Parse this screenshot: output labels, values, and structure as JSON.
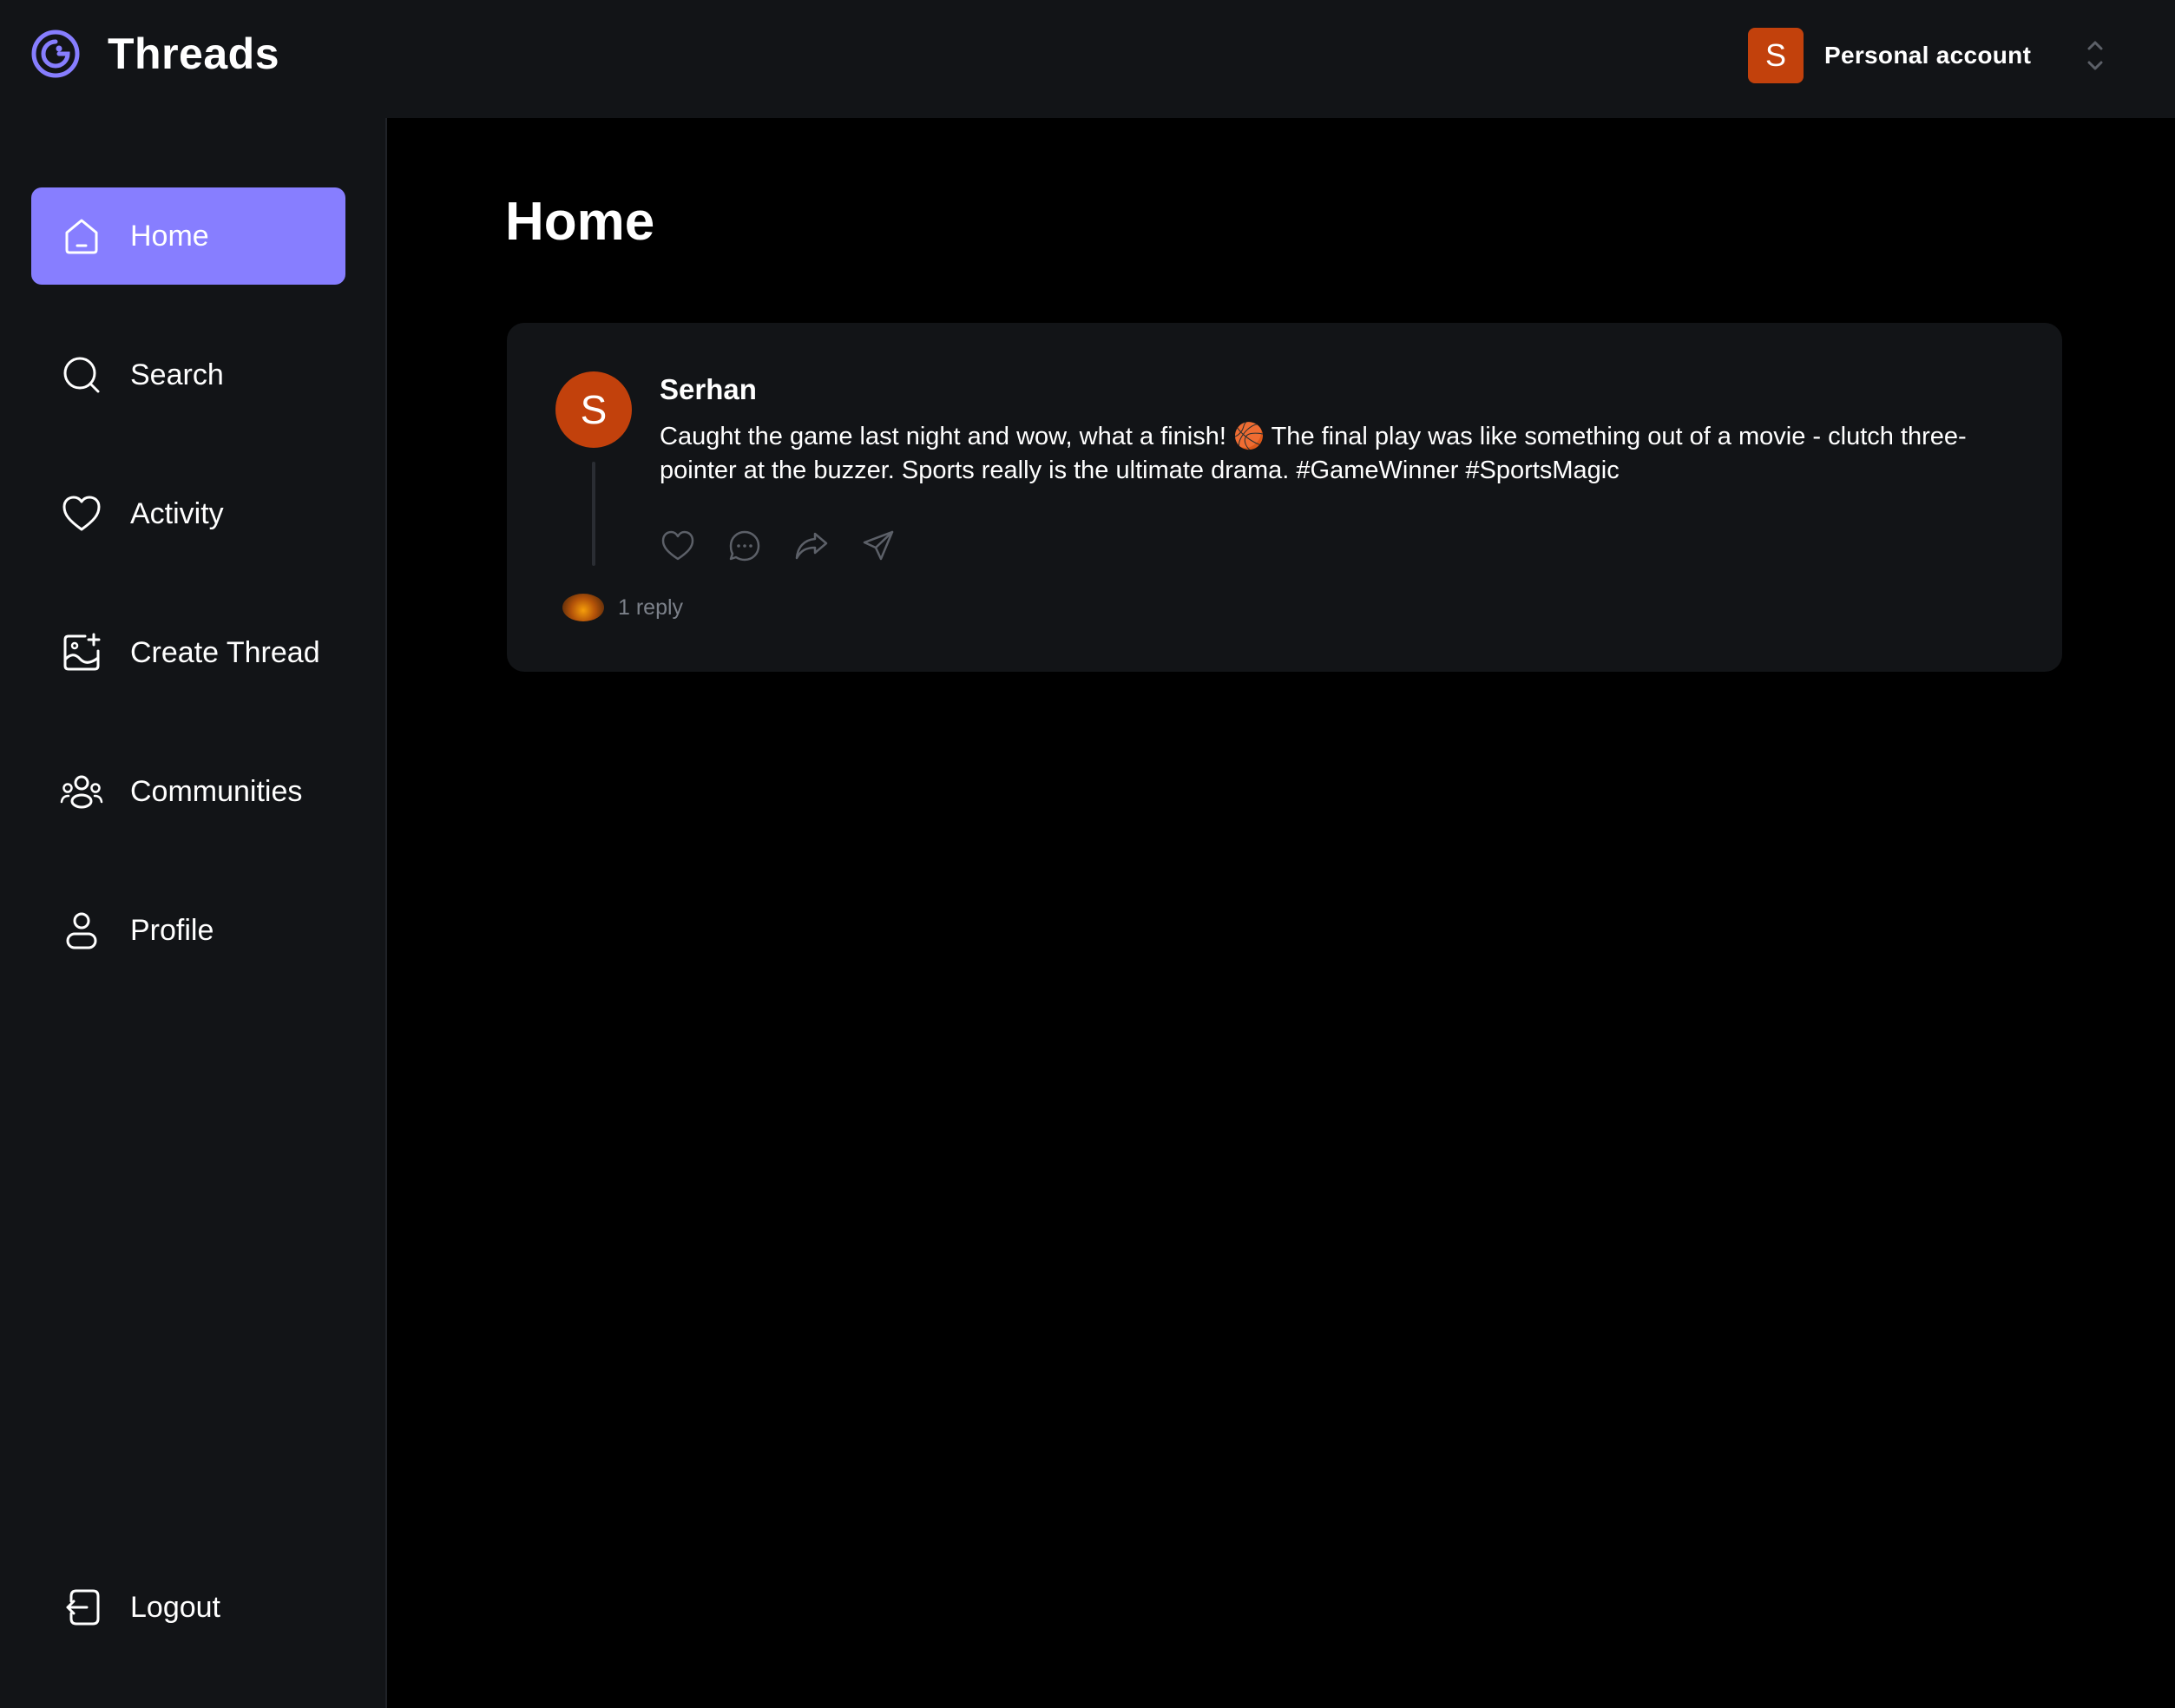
{
  "app": {
    "title": "Threads",
    "accent_color": "#877eff"
  },
  "account": {
    "avatar_letter": "S",
    "avatar_color": "#c2410c",
    "label": "Personal account"
  },
  "sidebar": {
    "items": [
      {
        "label": "Home",
        "icon": "home-icon",
        "active": true
      },
      {
        "label": "Search",
        "icon": "search-icon",
        "active": false
      },
      {
        "label": "Activity",
        "icon": "heart-icon",
        "active": false
      },
      {
        "label": "Create Thread",
        "icon": "image-plus-icon",
        "active": false
      },
      {
        "label": "Communities",
        "icon": "users-icon",
        "active": false
      },
      {
        "label": "Profile",
        "icon": "user-icon",
        "active": false
      }
    ],
    "logout": {
      "label": "Logout",
      "icon": "logout-icon"
    }
  },
  "main": {
    "title": "Home",
    "threads": [
      {
        "author": "Serhan",
        "author_initial": "S",
        "text": "Caught the game last night and wow, what a finish! 🏀 The final play was like something out of a movie - clutch three-pointer at the buzzer. Sports really is the ultimate drama. #GameWinner #SportsMagic",
        "actions": [
          "heart-icon",
          "reply-icon",
          "repost-icon",
          "share-icon"
        ],
        "replies_label": "1 reply"
      }
    ]
  }
}
